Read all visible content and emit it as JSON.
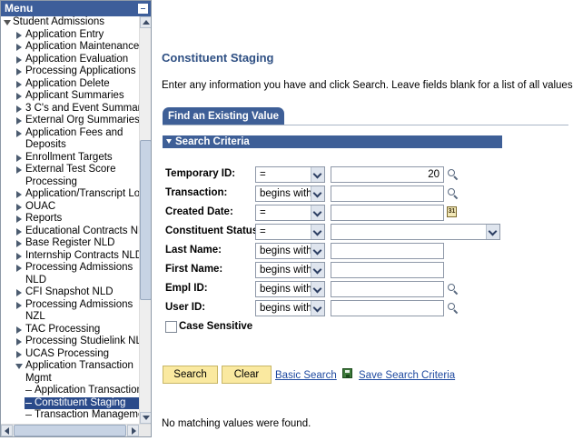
{
  "menu": {
    "title": "Menu",
    "root": "Student Admissions",
    "items": [
      {
        "label": "Application Entry",
        "type": "folder"
      },
      {
        "label": "Application Maintenance",
        "type": "folder"
      },
      {
        "label": "Application Evaluation",
        "type": "folder"
      },
      {
        "label": "Processing Applications",
        "type": "folder"
      },
      {
        "label": "Application Delete",
        "type": "folder"
      },
      {
        "label": "Applicant Summaries",
        "type": "folder"
      },
      {
        "label": "3 C's and Event Summari",
        "type": "folder"
      },
      {
        "label": "External Org Summaries",
        "type": "folder"
      },
      {
        "label": "Application Fees and",
        "type": "folder"
      },
      {
        "label": "Deposits",
        "type": "cont"
      },
      {
        "label": "Enrollment Targets",
        "type": "folder"
      },
      {
        "label": "External Test Score",
        "type": "folder"
      },
      {
        "label": "Processing",
        "type": "cont"
      },
      {
        "label": "Application/Transcript Loa",
        "type": "folder"
      },
      {
        "label": "OUAC",
        "type": "folder"
      },
      {
        "label": "Reports",
        "type": "folder"
      },
      {
        "label": "Educational Contracts NL",
        "type": "folder"
      },
      {
        "label": "Base Register NLD",
        "type": "folder"
      },
      {
        "label": "Internship Contracts NLD",
        "type": "folder"
      },
      {
        "label": "Processing Admissions",
        "type": "folder"
      },
      {
        "label": "NLD",
        "type": "cont"
      },
      {
        "label": "CFI Snapshot NLD",
        "type": "folder"
      },
      {
        "label": "Processing Admissions",
        "type": "folder"
      },
      {
        "label": "NZL",
        "type": "cont"
      },
      {
        "label": "TAC Processing",
        "type": "folder"
      },
      {
        "label": "Processing Studielink NL",
        "type": "folder"
      },
      {
        "label": "UCAS Processing",
        "type": "folder"
      },
      {
        "label": "Application Transaction",
        "type": "open"
      },
      {
        "label": "Mgmt",
        "type": "cont"
      },
      {
        "label": "Application Transaction",
        "type": "page"
      },
      {
        "label": "Constituent Staging",
        "type": "page-selected"
      },
      {
        "label": "Transaction Manageme",
        "type": "page"
      }
    ]
  },
  "page": {
    "title": "Constituent Staging",
    "instructions": "Enter any information you have and click Search. Leave fields blank for a list of all values.",
    "tab_label": "Find an Existing Value",
    "section_label": "Search Criteria"
  },
  "fields": [
    {
      "label": "Temporary ID:",
      "operator": "=",
      "value": "20",
      "suffix": "lookup"
    },
    {
      "label": "Transaction:",
      "operator": "begins with",
      "value": "",
      "suffix": "lookup"
    },
    {
      "label": "Created Date:",
      "operator": "=",
      "value": "",
      "suffix": "calendar"
    },
    {
      "label": "Constituent Status:",
      "operator": "=",
      "value": "",
      "suffix": "dropdown"
    },
    {
      "label": "Last Name:",
      "operator": "begins with",
      "value": "",
      "suffix": "none"
    },
    {
      "label": "First Name:",
      "operator": "begins with",
      "value": "",
      "suffix": "none"
    },
    {
      "label": "Empl ID:",
      "operator": "begins with",
      "value": "",
      "suffix": "lookup"
    },
    {
      "label": "User ID:",
      "operator": "begins with",
      "value": "",
      "suffix": "lookup"
    }
  ],
  "case_sensitive_label": "Case Sensitive",
  "buttons": {
    "search": "Search",
    "clear": "Clear",
    "basic_search": "Basic Search",
    "save_search": "Save Search Criteria"
  },
  "calendar_icon_text": "31",
  "no_match": "No matching values were found.",
  "colors": {
    "header_blue": "#3e5f97",
    "title_blue": "#2e4f83",
    "button_yellow": "#fae9a0",
    "link_blue": "#1f4aa0"
  }
}
